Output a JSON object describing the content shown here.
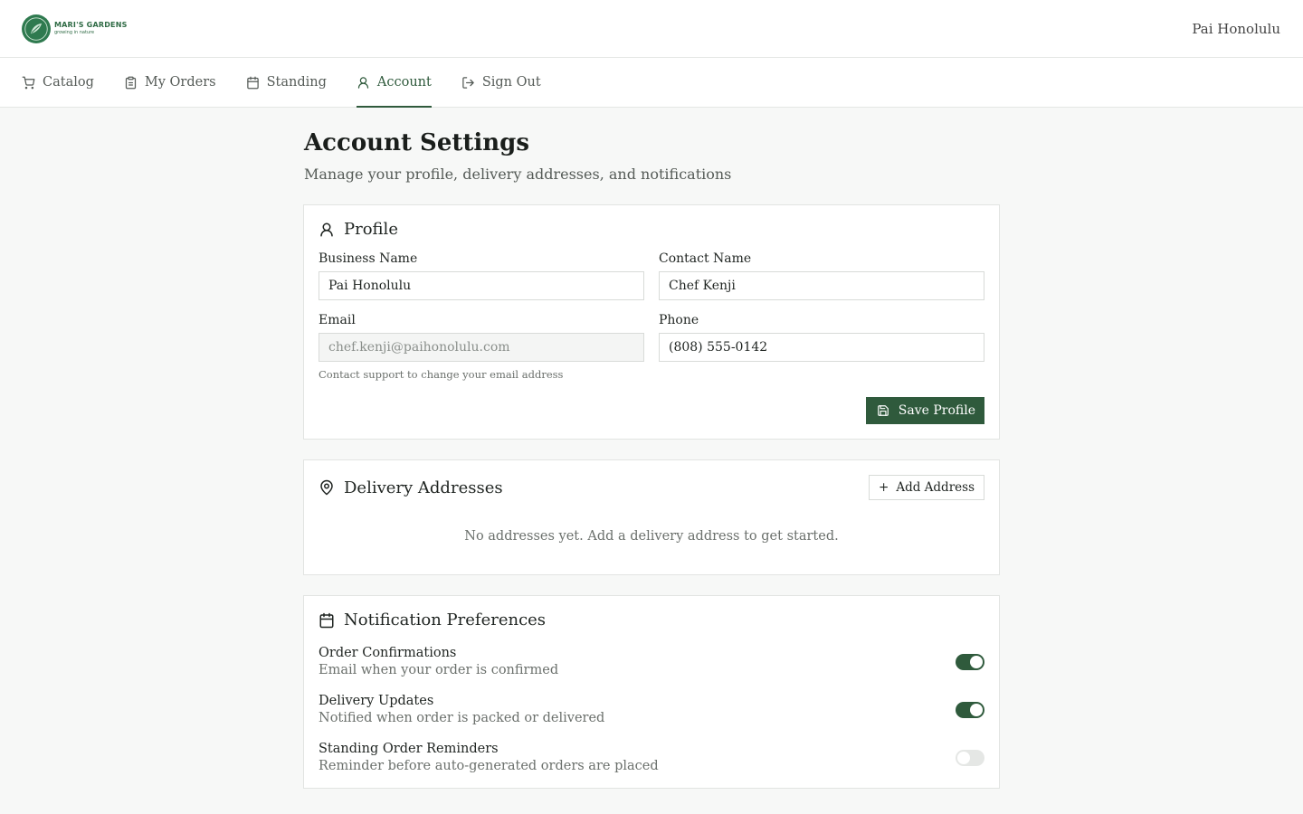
{
  "header": {
    "logo_name": "MARI'S GARDENS",
    "logo_tagline": "growing in nature",
    "user_name": "Pai Honolulu"
  },
  "nav": {
    "items": [
      {
        "label": "Catalog",
        "icon": "cart-icon"
      },
      {
        "label": "My Orders",
        "icon": "clipboard-icon"
      },
      {
        "label": "Standing",
        "icon": "calendar-icon"
      },
      {
        "label": "Account",
        "icon": "user-icon",
        "active": true
      },
      {
        "label": "Sign Out",
        "icon": "sign-out-icon"
      }
    ]
  },
  "page": {
    "title": "Account Settings",
    "subtitle": "Manage your profile, delivery addresses, and notifications"
  },
  "profile": {
    "title": "Profile",
    "business_name_label": "Business Name",
    "business_name_value": "Pai Honolulu",
    "contact_name_label": "Contact Name",
    "contact_name_value": "Chef Kenji",
    "email_label": "Email",
    "email_value": "chef.kenji@paihonolulu.com",
    "email_hint": "Contact support to change your email address",
    "phone_label": "Phone",
    "phone_value": "(808) 555-0142",
    "save_label": "Save Profile"
  },
  "addresses": {
    "title": "Delivery Addresses",
    "add_label": "Add Address",
    "empty_text": "No addresses yet. Add a delivery address to get started."
  },
  "notifications": {
    "title": "Notification Preferences",
    "items": [
      {
        "label": "Order Confirmations",
        "desc": "Email when your order is confirmed",
        "enabled": true
      },
      {
        "label": "Delivery Updates",
        "desc": "Notified when order is packed or delivered",
        "enabled": true
      },
      {
        "label": "Standing Order Reminders",
        "desc": "Reminder before auto-generated orders are placed",
        "enabled": false
      }
    ]
  },
  "colors": {
    "brand": "#2f5a3c",
    "logo": "#2f7a4f"
  }
}
